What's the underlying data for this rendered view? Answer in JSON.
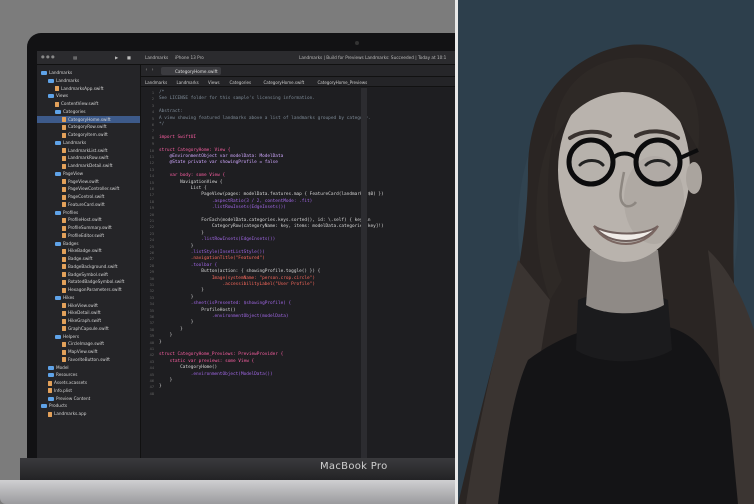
{
  "colors": {
    "left_background": "#7c7c7c",
    "right_background": "#2d3f4c",
    "divider": "#e8e8e8"
  },
  "laptop": {
    "brand_label": "MacBook Pro"
  },
  "xcode": {
    "toolbar": {
      "scheme": "Landmarks",
      "device": "iPhone 13 Pro",
      "status": "Landmarks | Build for Previews Landmarks: Succeeded | Today at 10:1"
    },
    "active_tab": "CategoryHome.swift",
    "breadcrumbs": [
      "Landmarks",
      "Landmarks",
      "Views",
      "Categories",
      "CategoryHome.swift",
      "CategoryHome_Previews"
    ],
    "navigator": [
      {
        "label": "Landmarks",
        "indent": 0,
        "kind": "folder"
      },
      {
        "label": "Landmarks",
        "indent": 1,
        "kind": "folder"
      },
      {
        "label": "LandmarksApp.swift",
        "indent": 2,
        "kind": "file"
      },
      {
        "label": "Views",
        "indent": 1,
        "kind": "folder"
      },
      {
        "label": "ContentView.swift",
        "indent": 2,
        "kind": "file"
      },
      {
        "label": "Categories",
        "indent": 2,
        "kind": "folder"
      },
      {
        "label": "CategoryHome.swift",
        "indent": 3,
        "kind": "file",
        "selected": true
      },
      {
        "label": "CategoryRow.swift",
        "indent": 3,
        "kind": "file"
      },
      {
        "label": "CategoryItem.swift",
        "indent": 3,
        "kind": "file"
      },
      {
        "label": "Landmarks",
        "indent": 2,
        "kind": "folder"
      },
      {
        "label": "LandmarkList.swift",
        "indent": 3,
        "kind": "file"
      },
      {
        "label": "LandmarkRow.swift",
        "indent": 3,
        "kind": "file"
      },
      {
        "label": "LandmarkDetail.swift",
        "indent": 3,
        "kind": "file"
      },
      {
        "label": "PageView",
        "indent": 2,
        "kind": "folder"
      },
      {
        "label": "PageView.swift",
        "indent": 3,
        "kind": "file"
      },
      {
        "label": "PageViewController.swift",
        "indent": 3,
        "kind": "file"
      },
      {
        "label": "PageControl.swift",
        "indent": 3,
        "kind": "file"
      },
      {
        "label": "FeatureCard.swift",
        "indent": 3,
        "kind": "file"
      },
      {
        "label": "Profiles",
        "indent": 2,
        "kind": "folder"
      },
      {
        "label": "ProfileHost.swift",
        "indent": 3,
        "kind": "file"
      },
      {
        "label": "ProfileSummary.swift",
        "indent": 3,
        "kind": "file"
      },
      {
        "label": "ProfileEditor.swift",
        "indent": 3,
        "kind": "file"
      },
      {
        "label": "Badges",
        "indent": 2,
        "kind": "folder"
      },
      {
        "label": "HikeBadge.swift",
        "indent": 3,
        "kind": "file"
      },
      {
        "label": "Badge.swift",
        "indent": 3,
        "kind": "file"
      },
      {
        "label": "BadgeBackground.swift",
        "indent": 3,
        "kind": "file"
      },
      {
        "label": "BadgeSymbol.swift",
        "indent": 3,
        "kind": "file"
      },
      {
        "label": "RotatedBadgeSymbol.swift",
        "indent": 3,
        "kind": "file"
      },
      {
        "label": "HexagonParameters.swift",
        "indent": 3,
        "kind": "file"
      },
      {
        "label": "Hikes",
        "indent": 2,
        "kind": "folder"
      },
      {
        "label": "HikeView.swift",
        "indent": 3,
        "kind": "file"
      },
      {
        "label": "HikeDetail.swift",
        "indent": 3,
        "kind": "file"
      },
      {
        "label": "HikeGraph.swift",
        "indent": 3,
        "kind": "file"
      },
      {
        "label": "GraphCapsule.swift",
        "indent": 3,
        "kind": "file"
      },
      {
        "label": "Helpers",
        "indent": 2,
        "kind": "folder"
      },
      {
        "label": "CircleImage.swift",
        "indent": 3,
        "kind": "file"
      },
      {
        "label": "MapView.swift",
        "indent": 3,
        "kind": "file"
      },
      {
        "label": "FavoriteButton.swift",
        "indent": 3,
        "kind": "file"
      },
      {
        "label": "Model",
        "indent": 1,
        "kind": "folder"
      },
      {
        "label": "Resources",
        "indent": 1,
        "kind": "folder"
      },
      {
        "label": "Assets.xcassets",
        "indent": 1,
        "kind": "file"
      },
      {
        "label": "Info.plist",
        "indent": 1,
        "kind": "file"
      },
      {
        "label": "Preview Content",
        "indent": 1,
        "kind": "folder"
      },
      {
        "label": "Products",
        "indent": 0,
        "kind": "folder"
      },
      {
        "label": "Landmarks.app",
        "indent": 1,
        "kind": "file"
      }
    ],
    "code": [
      {
        "n": "1",
        "text": "/*",
        "c": "#7f8c98"
      },
      {
        "n": "2",
        "text": "See LICENSE folder for this sample's licensing information.",
        "c": "#7f8c98"
      },
      {
        "n": "3",
        "text": "",
        "c": "#7f8c98"
      },
      {
        "n": "4",
        "text": "Abstract:",
        "c": "#7f8c98"
      },
      {
        "n": "5",
        "text": "A view showing featured landmarks above a list of landmarks grouped by category.",
        "c": "#7f8c98"
      },
      {
        "n": "6",
        "text": "*/",
        "c": "#7f8c98"
      },
      {
        "n": "7",
        "text": "",
        "c": "#d9d9d9"
      },
      {
        "n": "8",
        "text": "import SwiftUI",
        "c": "#fc5fa3"
      },
      {
        "n": "9",
        "text": "",
        "c": "#d9d9d9"
      },
      {
        "n": "10",
        "text": "struct CategoryHome: View {",
        "c": "#fc5fa3"
      },
      {
        "n": "11",
        "text": "    @EnvironmentObject var modelData: ModelData",
        "c": "#d0a8ff"
      },
      {
        "n": "12",
        "text": "    @State private var showingProfile = false",
        "c": "#d0a8ff"
      },
      {
        "n": "13",
        "text": "",
        "c": "#d9d9d9"
      },
      {
        "n": "14",
        "text": "    var body: some View {",
        "c": "#fc5fa3"
      },
      {
        "n": "15",
        "text": "        NavigationView {",
        "c": "#d9d9d9"
      },
      {
        "n": "16",
        "text": "            List {",
        "c": "#d9d9d9"
      },
      {
        "n": "17",
        "text": "                PageView(pages: modelData.features.map { FeatureCard(landmark: $0) })",
        "c": "#d9d9d9"
      },
      {
        "n": "18",
        "text": "                    .aspectRatio(3 / 2, contentMode: .fit)",
        "c": "#a167e6"
      },
      {
        "n": "19",
        "text": "                    .listRowInsets(EdgeInsets())",
        "c": "#a167e6"
      },
      {
        "n": "20",
        "text": "",
        "c": "#d9d9d9"
      },
      {
        "n": "21",
        "text": "                ForEach(modelData.categories.keys.sorted(), id: \\.self) { key in",
        "c": "#d9d9d9"
      },
      {
        "n": "22",
        "text": "                    CategoryRow(categoryName: key, items: modelData.categories[key]!)",
        "c": "#d9d9d9"
      },
      {
        "n": "23",
        "text": "                }",
        "c": "#d9d9d9"
      },
      {
        "n": "24",
        "text": "                .listRowInsets(EdgeInsets())",
        "c": "#a167e6"
      },
      {
        "n": "25",
        "text": "            }",
        "c": "#d9d9d9"
      },
      {
        "n": "26",
        "text": "            .listStyle(InsetListStyle())",
        "c": "#a167e6"
      },
      {
        "n": "27",
        "text": "            .navigationTitle(\"Featured\")",
        "c": "#fc6a5d"
      },
      {
        "n": "28",
        "text": "            .toolbar {",
        "c": "#a167e6"
      },
      {
        "n": "29",
        "text": "                Button(action: { showingProfile.toggle() }) {",
        "c": "#d9d9d9"
      },
      {
        "n": "30",
        "text": "                    Image(systemName: \"person.crop.circle\")",
        "c": "#fc6a5d"
      },
      {
        "n": "31",
        "text": "                        .accessibilityLabel(\"User Profile\")",
        "c": "#fc6a5d"
      },
      {
        "n": "32",
        "text": "                }",
        "c": "#d9d9d9"
      },
      {
        "n": "33",
        "text": "            }",
        "c": "#d9d9d9"
      },
      {
        "n": "34",
        "text": "            .sheet(isPresented: $showingProfile) {",
        "c": "#a167e6"
      },
      {
        "n": "35",
        "text": "                ProfileHost()",
        "c": "#d9d9d9"
      },
      {
        "n": "36",
        "text": "                    .environmentObject(modelData)",
        "c": "#a167e6"
      },
      {
        "n": "37",
        "text": "            }",
        "c": "#d9d9d9"
      },
      {
        "n": "38",
        "text": "        }",
        "c": "#d9d9d9"
      },
      {
        "n": "39",
        "text": "    }",
        "c": "#d9d9d9"
      },
      {
        "n": "40",
        "text": "}",
        "c": "#d9d9d9"
      },
      {
        "n": "41",
        "text": "",
        "c": "#d9d9d9"
      },
      {
        "n": "42",
        "text": "struct CategoryHome_Previews: PreviewProvider {",
        "c": "#fc5fa3"
      },
      {
        "n": "43",
        "text": "    static var previews: some View {",
        "c": "#fc5fa3"
      },
      {
        "n": "44",
        "text": "        CategoryHome()",
        "c": "#d9d9d9"
      },
      {
        "n": "45",
        "text": "            .environmentObject(ModelData())",
        "c": "#a167e6"
      },
      {
        "n": "46",
        "text": "    }",
        "c": "#d9d9d9"
      },
      {
        "n": "47",
        "text": "}",
        "c": "#d9d9d9"
      },
      {
        "n": "48",
        "text": "",
        "c": "#d9d9d9"
      }
    ]
  }
}
